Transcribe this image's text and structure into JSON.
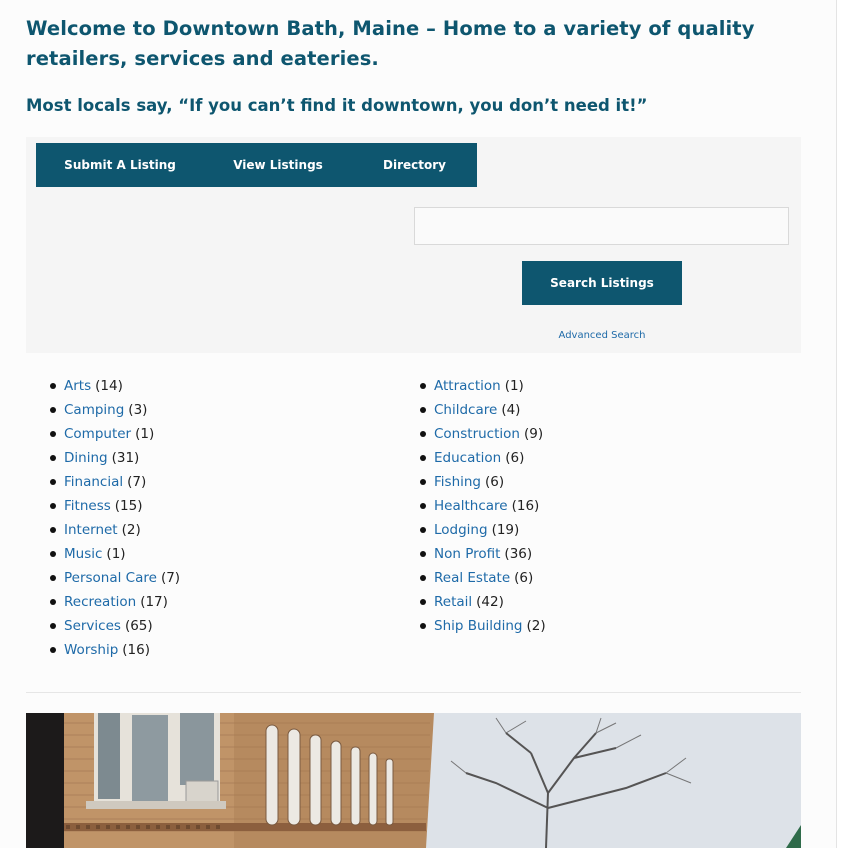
{
  "header": {
    "headline": "Welcome to Downtown Bath, Maine – Home to a variety of quality retailers, services and eateries.",
    "subhead": "Most locals say, “If you can’t find it downtown, you don’t need it!”"
  },
  "nav": {
    "tabs": [
      {
        "label": "Submit A Listing"
      },
      {
        "label": "View Listings"
      },
      {
        "label": "Directory"
      }
    ]
  },
  "search": {
    "value": "",
    "placeholder": "",
    "button_label": "Search Listings",
    "advanced_label": "Advanced Search"
  },
  "categories": {
    "left": [
      {
        "name": "Arts",
        "count": "(14)"
      },
      {
        "name": "Camping",
        "count": "(3)"
      },
      {
        "name": "Computer",
        "count": "(1)"
      },
      {
        "name": "Dining",
        "count": "(31)"
      },
      {
        "name": "Financial",
        "count": "(7)"
      },
      {
        "name": "Fitness",
        "count": "(15)"
      },
      {
        "name": "Internet",
        "count": "(2)"
      },
      {
        "name": "Music",
        "count": "(1)"
      },
      {
        "name": "Personal Care",
        "count": "(7)"
      },
      {
        "name": "Recreation",
        "count": "(17)"
      },
      {
        "name": "Services",
        "count": "(65)"
      },
      {
        "name": "Worship",
        "count": "(16)"
      }
    ],
    "right": [
      {
        "name": "Attraction",
        "count": "(1)"
      },
      {
        "name": "Childcare",
        "count": "(4)"
      },
      {
        "name": "Construction",
        "count": "(9)"
      },
      {
        "name": "Education",
        "count": "(6)"
      },
      {
        "name": "Fishing",
        "count": "(6)"
      },
      {
        "name": "Healthcare",
        "count": "(16)"
      },
      {
        "name": "Lodging",
        "count": "(19)"
      },
      {
        "name": "Non Profit",
        "count": "(36)"
      },
      {
        "name": "Real Estate",
        "count": "(6)"
      },
      {
        "name": "Retail",
        "count": "(42)"
      },
      {
        "name": "Ship Building",
        "count": "(2)"
      }
    ]
  },
  "colors": {
    "brand": "#0e566f",
    "link": "#1e6aa8",
    "panel": "#f5f5f5"
  }
}
